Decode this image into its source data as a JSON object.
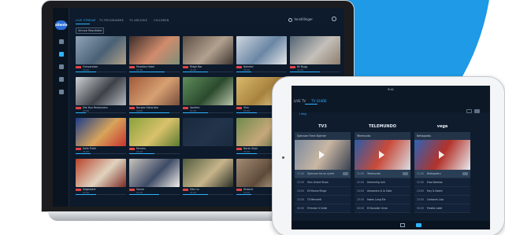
{
  "colors": {
    "accent": "#2fb3ff",
    "bg": "#0d1a2b",
    "brand_blue": "#1e9ae6"
  },
  "laptop": {
    "brand": "allente",
    "sidebar": [
      {
        "label": "Home",
        "icon": "home-icon"
      },
      {
        "label": "TV",
        "icon": "tv-icon"
      },
      {
        "label": "Search",
        "icon": "search-icon"
      },
      {
        "label": "Kids",
        "icon": "kids-icon"
      },
      {
        "label": "Settings",
        "icon": "gear-icon"
      }
    ],
    "tabs": [
      "LIVE STREAM",
      "TV PROGRAMME",
      "TV ARCHIVE",
      "CHILDREN"
    ],
    "user": "Innstillinger",
    "filter": "Vinnye Resultater",
    "cards": [
      {
        "title": "Forsvarsbes",
        "sub": "21:00",
        "progress": 0.4,
        "colors": [
          "#8fa3b7",
          "#4a6175",
          "#b3a289"
        ]
      },
      {
        "title": "Paradise Hotel",
        "sub": "21:30",
        "progress": 0.7,
        "colors": [
          "#3a2c2a",
          "#d18c6c",
          "#7e8e7a"
        ]
      },
      {
        "title": "Ridge Bar",
        "sub": "21:00",
        "progress": 0.5,
        "colors": [
          "#5d4f45",
          "#b2a18f",
          "#3e3632"
        ]
      },
      {
        "title": "Nyheter",
        "sub": "21:00",
        "progress": 0.3,
        "colors": [
          "#cfd6df",
          "#6a86a4",
          "#e6e8ea"
        ]
      },
      {
        "title": "Bil Bygg",
        "sub": "21:00",
        "progress": 0.6,
        "colors": [
          "#526473",
          "#c5c0ba",
          "#8d7d6d"
        ]
      },
      {
        "title": "Det Nya Restaurans",
        "sub": "20:00",
        "progress": 0.2,
        "colors": [
          "#cfd3d6",
          "#3d4148",
          "#b6babe"
        ]
      },
      {
        "title": "Norges Historiske",
        "sub": "20:00",
        "progress": 0.8,
        "colors": [
          "#a05a3a",
          "#d6a072",
          "#7a4d3a"
        ]
      },
      {
        "title": "Sporten",
        "sub": "21:00",
        "progress": 0.5,
        "colors": [
          "#5f8d5a",
          "#2b4a2e",
          "#b9c4a8"
        ]
      },
      {
        "title": "Vinn",
        "sub": "21:00",
        "progress": 0.4,
        "colors": [
          "#d9b96b",
          "#a7823e",
          "#f1dba0"
        ]
      },
      {
        "title": "Nyhet",
        "sub": "21:00",
        "progress": 0.6,
        "colors": [
          "#6b6a5f",
          "#bcb5a1",
          "#2c2d2a"
        ]
      },
      {
        "title": "Kalle Trekk",
        "sub": "21:00",
        "progress": 0.3,
        "colors": [
          "#1d3d8a",
          "#d8a45a",
          "#c7332f"
        ]
      },
      {
        "title": "Farmen",
        "sub": "21:00",
        "progress": 0.5,
        "colors": [
          "#8aa23c",
          "#d9c16b",
          "#5a7a2f"
        ]
      },
      {
        "title": "",
        "sub": "",
        "progress": 0.0,
        "colors": [
          "#1a2a3e",
          "#22344b",
          "#1a2a3e"
        ]
      },
      {
        "title": "Norsk Skjal",
        "sub": "21:00",
        "progress": 0.4,
        "colors": [
          "#6e8a4b",
          "#c6a87a",
          "#4c5e3a"
        ]
      },
      {
        "title": "Farmen",
        "sub": "21:00",
        "progress": 0.7,
        "colors": [
          "#7ca1c9",
          "#b8c9d8",
          "#3b5a7a"
        ]
      },
      {
        "title": "Dagbladet",
        "sub": "21:00",
        "progress": 0.4,
        "colors": [
          "#b8442c",
          "#e0d3bf",
          "#7a2b23"
        ]
      },
      {
        "title": "Sanne",
        "sub": "21:00",
        "progress": 0.6,
        "colors": [
          "#c9c4bd",
          "#3e4b66",
          "#f1eee8"
        ]
      },
      {
        "title": "Vita Liv",
        "sub": "21:00",
        "progress": 0.5,
        "colors": [
          "#4f5b3d",
          "#c7b58b",
          "#2b2f27"
        ]
      },
      {
        "title": "Historie",
        "sub": "21:00",
        "progress": 0.3,
        "colors": [
          "#a38c73",
          "#5e4a3a",
          "#d5c3a6"
        ]
      },
      {
        "title": "Nytt",
        "sub": "21:00",
        "progress": 0.2,
        "colors": [
          "#8a2c2c",
          "#d4a594",
          "#3f2020"
        ]
      }
    ]
  },
  "tablet": {
    "time": "9:41",
    "tabs": [
      "LIVE TV",
      "TV GUIDE"
    ],
    "sort": "I dag",
    "columns": [
      {
        "logo": "TV3",
        "head": "Gjennom Flere Stjerner",
        "colors": [
          "#7b8aa0",
          "#c9b7a3",
          "#3a4150"
        ],
        "rows": [
          [
            "21:00",
            "Gjennom fra en nyhet"
          ],
          [
            "22:00",
            "Vinn Grand Show"
          ],
          [
            "23:00",
            "Et Manne Ringe"
          ],
          [
            "23:30",
            "Til Merverdi"
          ],
          [
            "00:00",
            "Frimmer 4 Snike"
          ]
        ]
      },
      {
        "logo": "TELEMUNDO",
        "head": "Telemundo",
        "colors": [
          "#2a5ca8",
          "#c94a3a",
          "#d9dde2"
        ],
        "rows": [
          [
            "21:00",
            "Telemundo"
          ],
          [
            "22:00",
            "Hemmelig hvit"
          ],
          [
            "23:00",
            "Alexandra & la Siste"
          ],
          [
            "23:30",
            "Faaen Lang Eie"
          ],
          [
            "00:00",
            "Et Kavalier Unna"
          ]
        ]
      },
      {
        "logo": "vega",
        "head": "Nettopadtu",
        "colors": [
          "#2e63b7",
          "#b3322a",
          "#e8eaed"
        ],
        "rows": [
          [
            "21:00",
            "Nettopadtu"
          ],
          [
            "22:00",
            "Elos Noticias"
          ],
          [
            "23:00",
            "Hoy & Noten"
          ],
          [
            "23:30",
            "Cartones Lisa"
          ],
          [
            "00:00",
            "Fresita Lakel"
          ]
        ]
      }
    ]
  }
}
